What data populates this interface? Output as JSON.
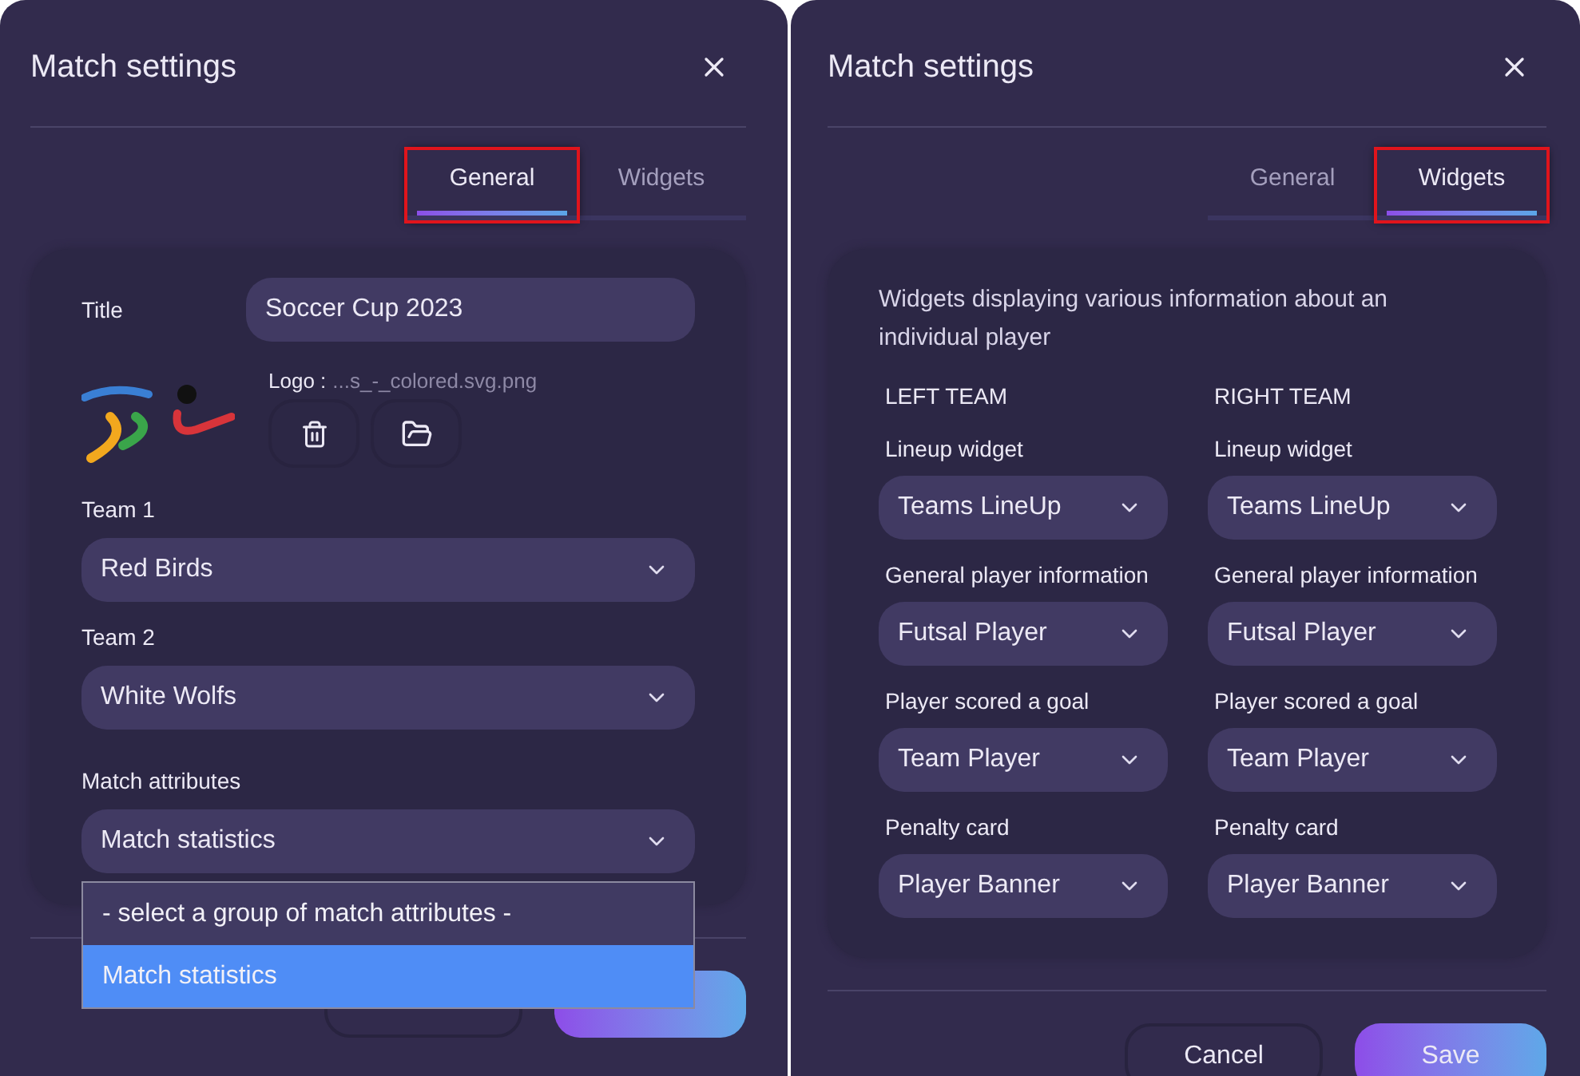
{
  "dialogs": [
    {
      "kind": "general",
      "title": "Match settings",
      "tabs": [
        {
          "label": "General",
          "selected": true,
          "highlighted": true
        },
        {
          "label": "Widgets",
          "selected": false,
          "highlighted": false
        }
      ],
      "general": {
        "title_label": "Title",
        "title_value": "Soccer Cup 2023",
        "logo_label": "Logo :",
        "logo_file": "...s_-_colored.svg.png",
        "selects": [
          {
            "label": "Team 1",
            "value": "Red Birds"
          },
          {
            "label": "Team 2",
            "value": "White Wolfs"
          },
          {
            "label": "Match attributes",
            "value": "Match statistics",
            "expanded": true,
            "options": [
              {
                "label": "- select a group of match attributes -",
                "selected": false
              },
              {
                "label": "Match statistics",
                "selected": true
              }
            ]
          }
        ]
      },
      "buttons": [
        {
          "kind": "cancel"
        },
        {
          "kind": "save"
        }
      ]
    },
    {
      "kind": "widgets",
      "title": "Match settings",
      "tabs": [
        {
          "label": "General",
          "selected": false,
          "highlighted": false
        },
        {
          "label": "Widgets",
          "selected": true,
          "highlighted": true
        }
      ],
      "widgets": {
        "description": "Widgets displaying various information about an individual player",
        "columns": [
          {
            "heading": "LEFT TEAM",
            "fields": [
              {
                "label": "Lineup widget",
                "value": "Teams LineUp"
              },
              {
                "label": "General player information",
                "value": "Futsal Player"
              },
              {
                "label": "Player scored a goal",
                "value": "Team Player"
              },
              {
                "label": "Penalty card",
                "value": "Player Banner"
              }
            ]
          },
          {
            "heading": "RIGHT TEAM",
            "fields": [
              {
                "label": "Lineup widget",
                "value": "Teams LineUp"
              },
              {
                "label": "General player information",
                "value": "Futsal Player"
              },
              {
                "label": "Player scored a goal",
                "value": "Team Player"
              },
              {
                "label": "Penalty card",
                "value": "Player Banner"
              }
            ]
          }
        ]
      },
      "buttons": [
        {
          "kind": "cancel",
          "label": "Cancel"
        },
        {
          "kind": "save",
          "label": "Save"
        }
      ]
    }
  ]
}
